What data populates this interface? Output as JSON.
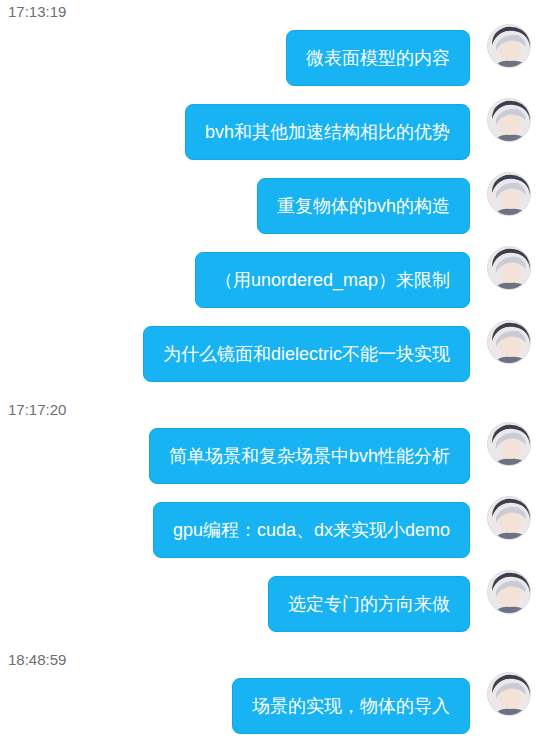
{
  "items": [
    {
      "kind": "time",
      "text": "17:13:19"
    },
    {
      "kind": "message",
      "text": "微表面模型的内容"
    },
    {
      "kind": "message",
      "text": "bvh和其他加速结构相比的优势"
    },
    {
      "kind": "message",
      "text": "重复物体的bvh的构造"
    },
    {
      "kind": "message",
      "text": "（用unordered_map）来限制"
    },
    {
      "kind": "message",
      "text": "为什么镜面和dielectric不能一块实现"
    },
    {
      "kind": "time",
      "text": "17:17:20"
    },
    {
      "kind": "message",
      "text": "简单场景和复杂场景中bvh性能分析"
    },
    {
      "kind": "message",
      "text": "gpu编程：cuda、dx来实现小demo"
    },
    {
      "kind": "message",
      "text": "选定专门的方向来做"
    },
    {
      "kind": "time",
      "text": "18:48:59"
    },
    {
      "kind": "message",
      "text": "场景的实现，物体的导入"
    }
  ]
}
